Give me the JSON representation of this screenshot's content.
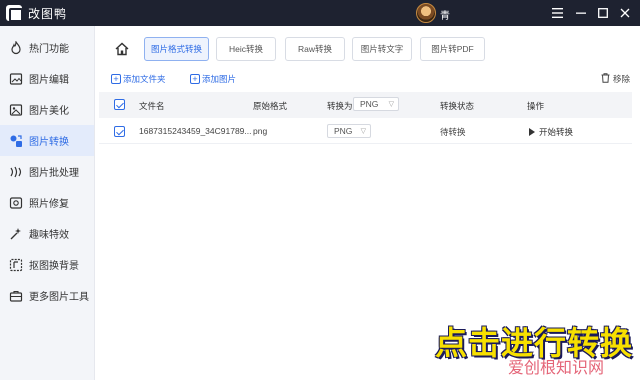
{
  "window": {
    "title": "改图鸭",
    "user_name": "青",
    "controls": [
      "menu-icon",
      "minimize-icon",
      "maximize-icon",
      "close-icon"
    ]
  },
  "sidebar": {
    "items": [
      {
        "label": "热门功能",
        "icon": "fire-icon",
        "active": false
      },
      {
        "label": "图片编辑",
        "icon": "image-edit-icon",
        "active": false
      },
      {
        "label": "图片美化",
        "icon": "image-beautify-icon",
        "active": false
      },
      {
        "label": "图片转换",
        "icon": "convert-icon",
        "active": true
      },
      {
        "label": "图片批处理",
        "icon": "batch-icon",
        "active": false
      },
      {
        "label": "照片修复",
        "icon": "repair-icon",
        "active": false
      },
      {
        "label": "趣味特效",
        "icon": "sparkle-icon",
        "active": false
      },
      {
        "label": "抠图换背景",
        "icon": "cutout-icon",
        "active": false
      },
      {
        "label": "更多图片工具",
        "icon": "toolbox-icon",
        "active": false
      }
    ]
  },
  "tabs": [
    {
      "label": "图片格式转换",
      "active": true
    },
    {
      "label": "Heic转换",
      "active": false
    },
    {
      "label": "Raw转换",
      "active": false
    },
    {
      "label": "图片转文字",
      "active": false
    },
    {
      "label": "图片转PDF",
      "active": false
    }
  ],
  "actions": {
    "add_folder": "添加文件夹",
    "add_image": "添加图片",
    "remove": "移除"
  },
  "table": {
    "columns": {
      "filename": "文件名",
      "original_format": "原始格式",
      "convert_to": "转换为",
      "convert_to_value": "PNG",
      "status": "转换状态",
      "operation": "操作"
    },
    "rows": [
      {
        "filename": "1687315243459_34C91789...",
        "original_format": "png",
        "target_format": "PNG",
        "status": "待转换",
        "action": "开始转换"
      }
    ]
  },
  "overlay": {
    "caption": "点击进行转换",
    "watermark": "爱创根知识网"
  },
  "colors": {
    "accent": "#2f6ce5",
    "titlebar": "#1e2230",
    "caption_yellow": "#f7e000"
  }
}
